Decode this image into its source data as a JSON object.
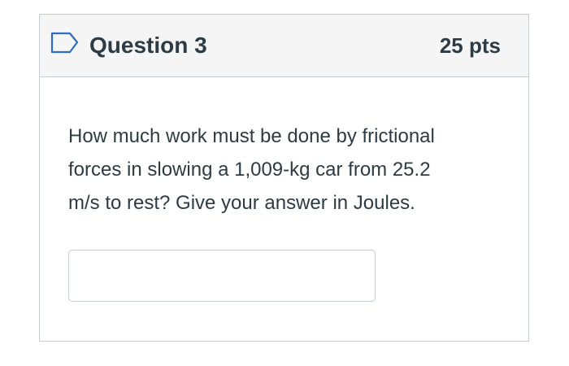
{
  "question": {
    "title": "Question 3",
    "points": "25 pts",
    "flag_icon": "flag-outline-icon",
    "text_lines": [
      "How much work must be done by frictional",
      "forces in slowing a 1,009-kg car from 25.2",
      "m/s to rest?  Give your answer in Joules."
    ],
    "answer": {
      "value": "",
      "placeholder": ""
    }
  },
  "colors": {
    "header_bg": "#f5f5f5",
    "border": "#c7cdd1",
    "text": "#2d3b45",
    "flag_stroke": "#2d6cc0"
  }
}
